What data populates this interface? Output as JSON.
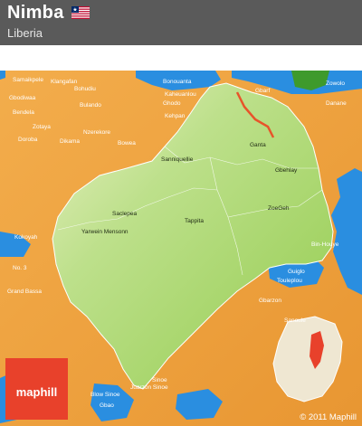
{
  "header": {
    "title": "Nimba",
    "subtitle": "Liberia",
    "flag_icon": "liberia-flag-icon"
  },
  "map": {
    "colors": {
      "region": "#a9d66d",
      "surroundings": "#f0a540",
      "water": "#2a8ee0",
      "header": "#5a5a5a",
      "brand": "#e8412b"
    },
    "labels": {
      "samaikpele": "Samaikpele",
      "gbodiwaa": "Gbodiwaa",
      "bendela": "Bendela",
      "doroba": "Doroba",
      "klangafan": "Klangafan",
      "bohudiu": "Bohudiu",
      "bulando": "Bulando",
      "zotaya": "Zotaya",
      "dikama": "Dikama",
      "nzerekore": "Nzerekore",
      "bowea": "Bowea",
      "bonouanta": "Bonouanta",
      "kaheuanlou": "Kaheuanlou",
      "ghodo": "Ghodo",
      "ganta": "Ganta",
      "sanniquellie": "Sanniquellie",
      "gbehlay": "Gbehlay",
      "saclepea": "Saclepea",
      "zoegeh": "ZoeGeh",
      "yarwein_mensonn": "Yarwein Mensonn",
      "tappita": "Tappita",
      "bin_houye": "Bin-Houye",
      "kokoyah": "Kokoyah",
      "district3": "No. 3",
      "grand_bassa": "Grand Bassa",
      "gbarzon": "Gbarzon",
      "sinoe": "Sinoe",
      "juarzon": "Juarzon Sinoe",
      "blow_sinoe": "Blow Sinoe",
      "gbao": "Gbao",
      "touleplou": "Touleplou",
      "guiglo": "Guiglo",
      "gbarf": "Gbarf",
      "sanoule": "Sanoule",
      "danane": "Danane",
      "zowolo": "Zowolo",
      "kehpan": "Kehpan"
    }
  },
  "branding": {
    "logo_text": "maphill",
    "copyright": "© 2011 Maphill"
  }
}
